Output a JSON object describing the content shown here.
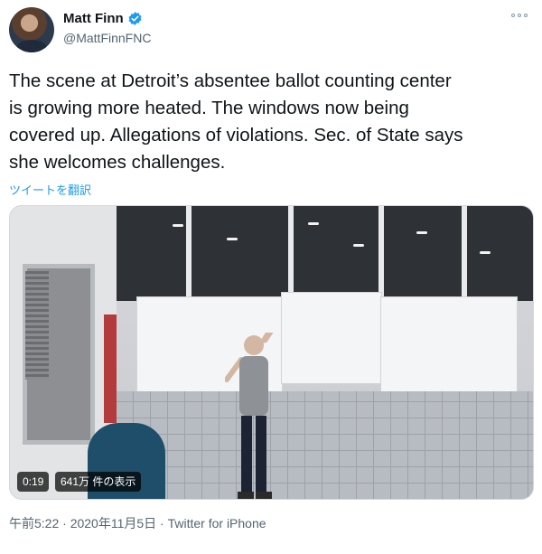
{
  "author": {
    "display_name": "Matt Finn",
    "handle": "@MattFinnFNC"
  },
  "tweet": {
    "text": "The scene at Detroit’s absentee ballot counting center\nis growing more heated.  The windows now being\ncovered up. Allegations of violations.   Sec. of State says\nshe welcomes challenges.",
    "translate_link": "ツイートを翻訳"
  },
  "video": {
    "duration": "0:19",
    "views": "641万 件の表示"
  },
  "meta": {
    "line": "午前5:22 · 2020年11月5日 · Twitter for iPhone"
  },
  "icons": {
    "verified": "verified-badge-icon",
    "more": "more-options-icon"
  },
  "colors": {
    "accent": "#1d9bf0",
    "secondary_text": "#536471"
  }
}
